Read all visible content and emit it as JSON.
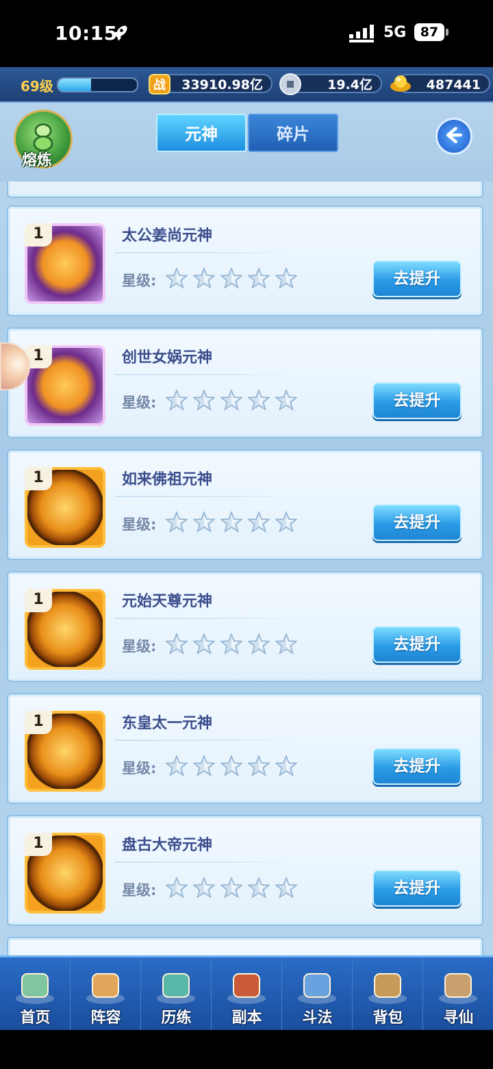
{
  "status_bar": {
    "time": "10:15",
    "network": "5G",
    "battery": "87"
  },
  "resources": {
    "level": "69级",
    "level_progress": 0.42,
    "power_icon_text": "战",
    "power": "33910.98亿",
    "silver": "19.4亿",
    "gold": "487441"
  },
  "top_nav": {
    "melt_label": "熔炼",
    "tabs": [
      {
        "label": "元神",
        "active": true
      },
      {
        "label": "碎片",
        "active": false
      }
    ]
  },
  "list": {
    "star_label": "星级:",
    "upgrade_label": "去提升",
    "items": [
      {
        "name": "太公姜尚元神",
        "level": "1",
        "stars": 0,
        "frame": "purple"
      },
      {
        "name": "创世女娲元神",
        "level": "1",
        "stars": 0,
        "frame": "purple"
      },
      {
        "name": "如来佛祖元神",
        "level": "1",
        "stars": 0,
        "frame": "gold"
      },
      {
        "name": "元始天尊元神",
        "level": "1",
        "stars": 0,
        "frame": "gold"
      },
      {
        "name": "东皇太一元神",
        "level": "1",
        "stars": 0,
        "frame": "gold"
      },
      {
        "name": "盘古大帝元神",
        "level": "1",
        "stars": 0,
        "frame": "gold"
      }
    ]
  },
  "bottom_nav": [
    {
      "label": "首页",
      "icon": "home-icon"
    },
    {
      "label": "阵容",
      "icon": "lineup-icon"
    },
    {
      "label": "历练",
      "icon": "training-icon"
    },
    {
      "label": "副本",
      "icon": "dungeon-icon"
    },
    {
      "label": "斗法",
      "icon": "battle-icon"
    },
    {
      "label": "背包",
      "icon": "bag-icon"
    },
    {
      "label": "寻仙",
      "icon": "seek-immortal-icon"
    }
  ]
}
